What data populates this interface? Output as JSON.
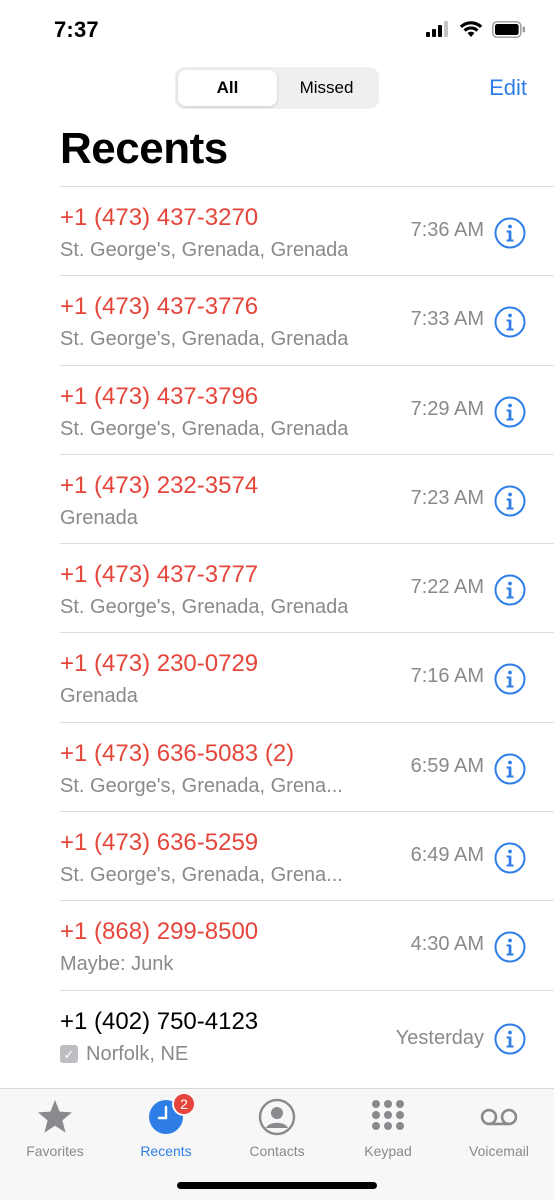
{
  "status_bar": {
    "time": "7:37"
  },
  "header": {
    "segments": [
      "All",
      "Missed"
    ],
    "active_segment": "All",
    "edit_label": "Edit",
    "title": "Recents"
  },
  "calls": [
    {
      "number": "+1 (473) 437-3270",
      "detail": "St. George's, Grenada, Grenada",
      "time": "7:36 AM",
      "missed": true
    },
    {
      "number": "+1 (473) 437-3776",
      "detail": "St. George's, Grenada, Grenada",
      "time": "7:33 AM",
      "missed": true
    },
    {
      "number": "+1 (473) 437-3796",
      "detail": "St. George's, Grenada, Grenada",
      "time": "7:29 AM",
      "missed": true
    },
    {
      "number": "+1 (473) 232-3574",
      "detail": "Grenada",
      "time": "7:23 AM",
      "missed": true
    },
    {
      "number": "+1 (473) 437-3777",
      "detail": "St. George's, Grenada, Grenada",
      "time": "7:22 AM",
      "missed": true
    },
    {
      "number": "+1 (473) 230-0729",
      "detail": "Grenada",
      "time": "7:16 AM",
      "missed": true
    },
    {
      "number": "+1 (473) 636-5083 (2)",
      "detail": "St. George's, Grenada, Grena...",
      "time": "6:59 AM",
      "missed": true
    },
    {
      "number": "+1 (473) 636-5259",
      "detail": "St. George's, Grenada, Grena...",
      "time": "6:49 AM",
      "missed": true
    },
    {
      "number": "+1 (868) 299-8500",
      "detail": "Maybe: Junk",
      "time": "4:30 AM",
      "missed": true
    },
    {
      "number": "+1 (402) 750-4123",
      "detail": "Norfolk, NE",
      "time": "Yesterday",
      "missed": false
    }
  ],
  "tab_bar": {
    "tabs": [
      {
        "label": "Favorites",
        "icon": "star-icon"
      },
      {
        "label": "Recents",
        "icon": "clock-icon",
        "badge": "2",
        "active": true
      },
      {
        "label": "Contacts",
        "icon": "person-circle-icon"
      },
      {
        "label": "Keypad",
        "icon": "keypad-icon"
      },
      {
        "label": "Voicemail",
        "icon": "voicemail-icon"
      }
    ]
  },
  "colors": {
    "missed": "#e5453a",
    "accent": "#2f7ee8",
    "secondary_text": "#8a8a8e"
  }
}
